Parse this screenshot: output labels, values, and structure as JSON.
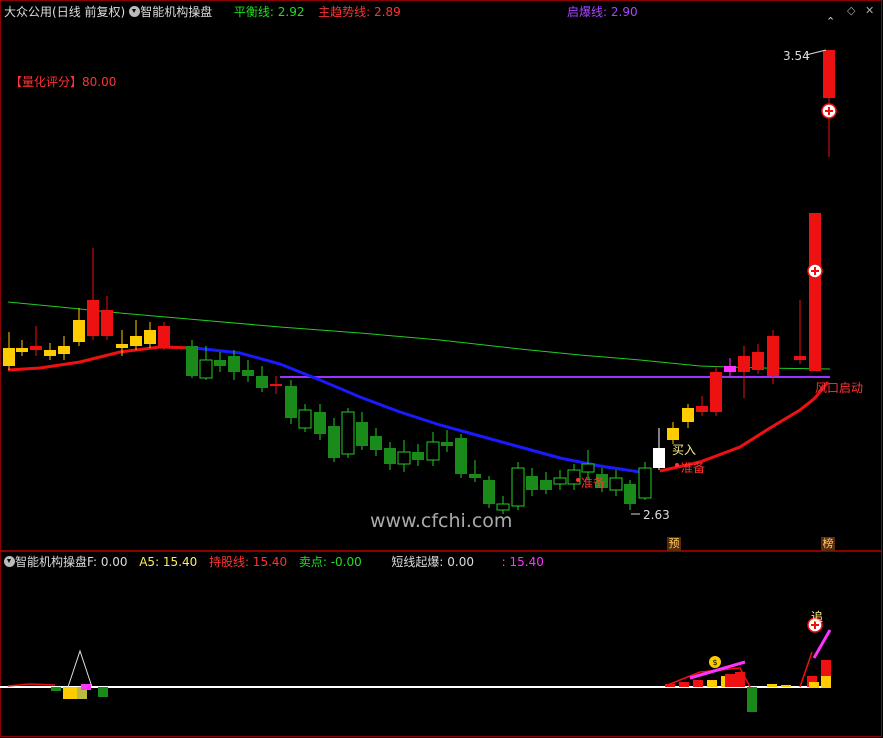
{
  "header": {
    "stock_name": "大众公用",
    "period": "(日线 前复权)",
    "indicator_name": "智能机构操盘",
    "balance_label": "平衡线",
    "balance_value": "2.92",
    "trend_label": "主趋势线",
    "trend_value": "2.89",
    "explode_label": "启爆线",
    "explode_value": "2.90"
  },
  "window_buttons": {
    "diamond": "◇",
    "close": "✕",
    "expand": "⌃"
  },
  "score": {
    "label": "【量化评分】",
    "value": "80.00"
  },
  "annotations": {
    "high_price": "3.54",
    "low_price": "2.63",
    "buy_label": "买入",
    "ready_label": "准备",
    "ready_label_2": "准备",
    "breakout_label": "风口启动",
    "pre_mark": "预",
    "bang_mark": "榜",
    "chase_label": "追",
    "watermark": "www.cfchi.com"
  },
  "sub_header": {
    "indicator": "智能机构操盘F",
    "f_value": ": 0.00",
    "a5_label": "A5",
    "a5_value": ": 15.40",
    "hold_label": "持股线",
    "hold_value": ": 15.40",
    "sell_label": "卖点",
    "sell_value": ": -0.00",
    "short_label": "短线起爆",
    "short_value": ": 0.00",
    "extra_value": ": 15.40"
  },
  "colors": {
    "up": "#ff0000",
    "down": "#00aa00",
    "yellow": "#ffcc00",
    "balance": "#00ff00",
    "trend": "#ff3333",
    "explode": "#aa44ff",
    "blue": "#1a1aff",
    "magenta": "#ff33ff"
  }
}
